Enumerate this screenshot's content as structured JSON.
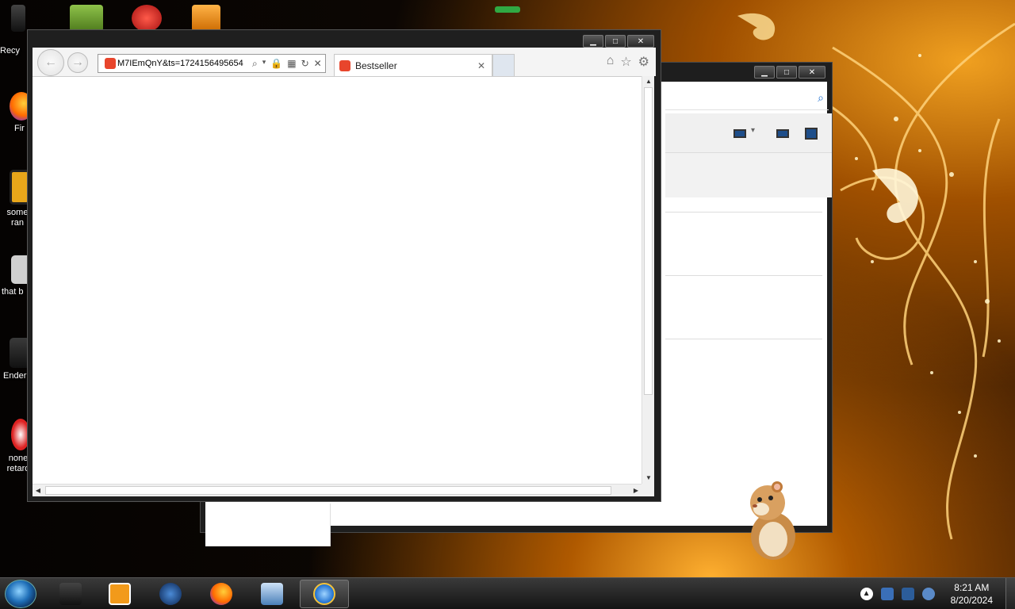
{
  "desktop": {
    "icons": [
      {
        "label": "Recy",
        "icon": "recycle-bin-icon"
      },
      {
        "label": "Fir",
        "icon": "firefox-icon"
      },
      {
        "label": "some ran",
        "icon": "media-icon"
      },
      {
        "label": "that b",
        "icon": "folder-icon"
      },
      {
        "label": "Ender",
        "icon": "game-icon"
      },
      {
        "label": "none retard",
        "icon": "app-icon"
      }
    ]
  },
  "ie": {
    "address": "M7IEmQnY&ts=1724156495654",
    "tab_title": "Bestseller",
    "tab_close": "✕",
    "close_glyph": "✕"
  },
  "clock": {
    "time": "8:21 AM",
    "date": "8/20/2024"
  },
  "colors": {
    "accent_red": "#e8452c",
    "ie_blue": "#1e6fd0"
  }
}
